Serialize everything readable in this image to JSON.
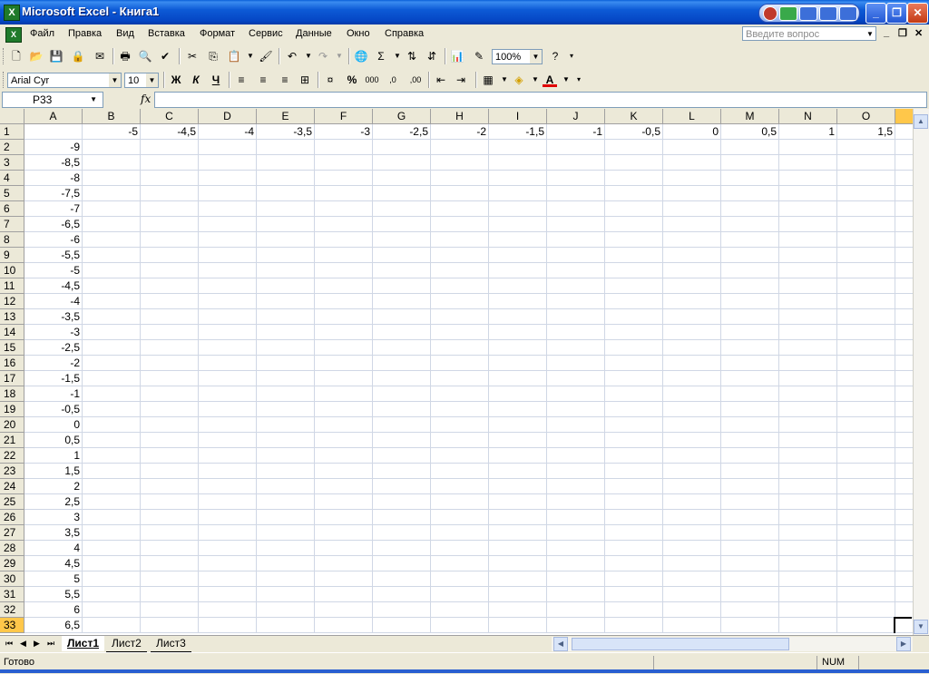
{
  "window": {
    "title": "Microsoft Excel - Книга1"
  },
  "menu": {
    "items": [
      "Файл",
      "Правка",
      "Вид",
      "Вставка",
      "Формат",
      "Сервис",
      "Данные",
      "Окно",
      "Справка"
    ],
    "ask_placeholder": "Введите вопрос"
  },
  "toolbar": {
    "zoom": "100%"
  },
  "format_toolbar": {
    "font": "Arial Cyr",
    "size": "10",
    "bold": "Ж",
    "italic": "К",
    "underline": "Ч"
  },
  "formula_bar": {
    "name_box": "P33",
    "fx": "fx",
    "value": ""
  },
  "grid": {
    "columns": [
      "A",
      "B",
      "C",
      "D",
      "E",
      "F",
      "G",
      "H",
      "I",
      "J",
      "K",
      "L",
      "M",
      "N",
      "O"
    ],
    "rows": [
      "1",
      "2",
      "3",
      "4",
      "5",
      "6",
      "7",
      "8",
      "9",
      "10",
      "11",
      "12",
      "13",
      "14",
      "15",
      "16",
      "17",
      "18",
      "19",
      "20",
      "21",
      "22",
      "23",
      "24",
      "25",
      "26",
      "27",
      "28",
      "29",
      "30",
      "31",
      "32",
      "33"
    ],
    "selected_row": "33",
    "row1_values": [
      "",
      "-5",
      "-4,5",
      "-4",
      "-3,5",
      "-3",
      "-2,5",
      "-2",
      "-1,5",
      "-1",
      "-0,5",
      "0",
      "0,5",
      "1",
      "1,5"
    ],
    "colA_values": [
      "",
      "-9",
      "-8,5",
      "-8",
      "-7,5",
      "-7",
      "-6,5",
      "-6",
      "-5,5",
      "-5",
      "-4,5",
      "-4",
      "-3,5",
      "-3",
      "-2,5",
      "-2",
      "-1,5",
      "-1",
      "-0,5",
      "0",
      "0,5",
      "1",
      "1,5",
      "2",
      "2,5",
      "3",
      "3,5",
      "4",
      "4,5",
      "5",
      "5,5",
      "6",
      "6,5"
    ]
  },
  "sheets": {
    "tabs": [
      "Лист1",
      "Лист2",
      "Лист3"
    ],
    "active": "Лист1"
  },
  "status": {
    "text": "Готово",
    "num": "NUM"
  }
}
